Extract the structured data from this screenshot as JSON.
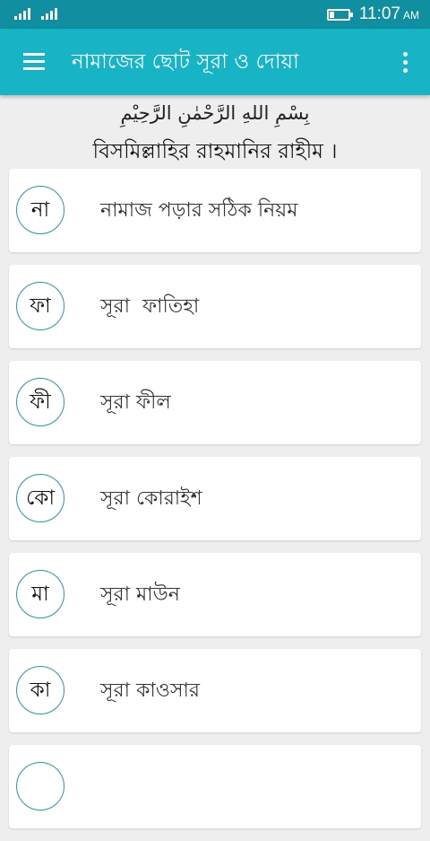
{
  "status_bar": {
    "time": "11:07",
    "ampm": "AM",
    "battery_level": 0.25,
    "icons": [
      "signal-icon",
      "signal-icon",
      "battery-icon"
    ]
  },
  "app_bar": {
    "title": "নামাজের ছোট সূরা ও দোয়া",
    "icons": [
      "menu-icon",
      "more-vertical-icon"
    ]
  },
  "header": {
    "arabic": "بِسْمِ اللهِ الرَّحْمٰنِ الرَّحِيْمِ",
    "bengali": "বিসমিল্লাহির রাহমানির রাহীম ।"
  },
  "items": [
    {
      "badge": "না",
      "label": "নামাজ পড়ার সঠিক নিয়ম"
    },
    {
      "badge": "ফা",
      "label": "সূরা  ফাতিহা"
    },
    {
      "badge": "ফী",
      "label": "সূরা ফীল"
    },
    {
      "badge": "কো",
      "label": "সূরা কোরাইশ"
    },
    {
      "badge": "মা",
      "label": "সূরা মাউন"
    },
    {
      "badge": "কা",
      "label": "সূরা কাওসার"
    }
  ],
  "colors": {
    "status_bar": "#0f8fa0",
    "app_bar": "#17b4c6",
    "badge_border": "#1e9bab",
    "background": "#eeeeee"
  }
}
